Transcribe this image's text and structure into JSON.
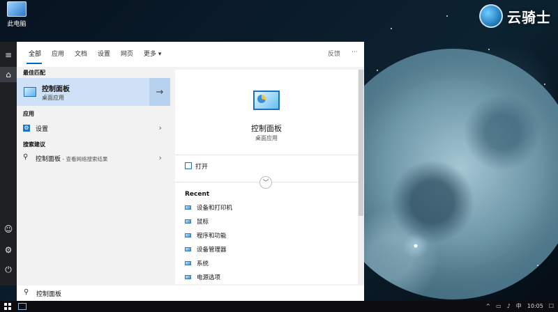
{
  "desktop": {
    "icon_label": "此电脑",
    "watermark": "云骑士"
  },
  "tabs": {
    "items": [
      "全部",
      "应用",
      "文档",
      "设置",
      "网页",
      "更多 ▾"
    ],
    "feedback": "反馈",
    "more": "···"
  },
  "results": {
    "best_match_title": "最佳匹配",
    "best_match": {
      "title": "控制面板",
      "subtitle": "桌面应用"
    },
    "apps_title": "应用",
    "apps": [
      {
        "label": "设置"
      }
    ],
    "web_title": "搜索建议",
    "web": {
      "label": "控制面板",
      "suffix": " - 查看网络搜索结果"
    }
  },
  "detail": {
    "name": "控制面板",
    "type": "桌面应用",
    "open_label": "打开",
    "recent_title": "Recent",
    "recent": [
      "设备和打印机",
      "鼠标",
      "程序和功能",
      "设备管理器",
      "系统",
      "电源选项"
    ]
  },
  "search": {
    "value": "控制面板"
  },
  "taskbar": {
    "ime": "中",
    "time": "10:05"
  },
  "icons": {
    "rail": [
      "hamburger-icon",
      "home-icon",
      "user-icon",
      "gear-icon",
      "power-icon"
    ],
    "best_match": "control-panel-icon",
    "settings": "gear-icon",
    "web": "search-icon"
  },
  "colors": {
    "accent": "#0067c0",
    "selected": "#cfe1f6"
  }
}
